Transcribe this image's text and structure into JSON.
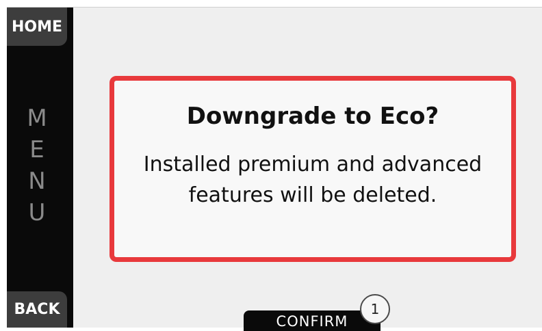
{
  "sidebar": {
    "home_label": "HOME",
    "menu_letters": [
      "M",
      "E",
      "N",
      "U"
    ],
    "back_label": "BACK"
  },
  "dialog": {
    "title": "Downgrade to Eco?",
    "message": "Installed premium and advanced features will be deleted."
  },
  "footer": {
    "confirm_label": "CONFIRM",
    "step_badge": "1"
  },
  "colors": {
    "accent_border": "#e8393c",
    "sidebar_bg": "#0a0a0a",
    "button_bg": "#3d3d3d"
  }
}
